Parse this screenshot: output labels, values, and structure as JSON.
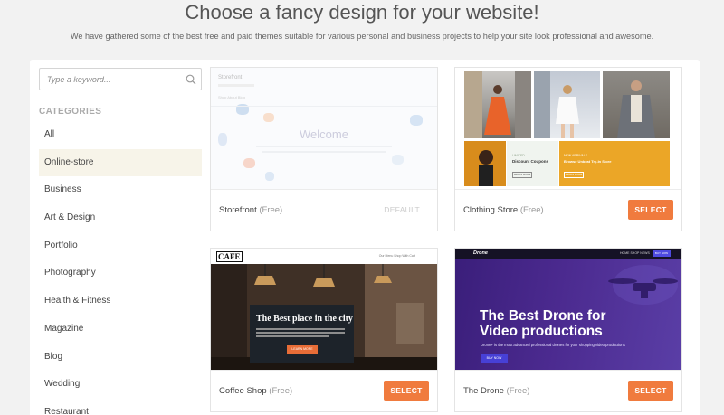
{
  "hero": {
    "title": "Choose a fancy design for your website!",
    "subtitle": "We have gathered some of the best free and paid themes suitable for various personal and business projects to help your site look professional and awesome."
  },
  "search": {
    "placeholder": "Type a keyword..."
  },
  "categories": {
    "heading": "CATEGORIES",
    "items": [
      "All",
      "Online-store",
      "Business",
      "Art & Design",
      "Portfolio",
      "Photography",
      "Health & Fitness",
      "Magazine",
      "Blog",
      "Wedding",
      "Restaurant"
    ],
    "active": "Online-store"
  },
  "themes": [
    {
      "name": "Storefront",
      "price": "(Free)",
      "action": "DEFAULT",
      "thumb": {
        "brand": "Storefront",
        "nav": "Shop   About   Blog",
        "headline": "Welcome"
      }
    },
    {
      "name": "Clothing Store",
      "price": "(Free)",
      "action": "SELECT",
      "thumb": {
        "promo_label": "LIMITED",
        "promo_title": "Discount Coupons",
        "promo_btn": "LEARN MORE",
        "promo2_label": "NEW ARRIVALS",
        "promo2_title": "Browse Unbeat Try-In Store",
        "promo2_btn": "LEARN MORE"
      }
    },
    {
      "name": "Coffee Shop",
      "price": "(Free)",
      "action": "SELECT",
      "thumb": {
        "logo": "CAFE",
        "nav": "Our Menu   Shop With   Cart",
        "headline": "The Best place in the city",
        "button": "LEARN MORE"
      }
    },
    {
      "name": "The Drone",
      "price": "(Free)",
      "action": "SELECT",
      "thumb": {
        "logo": "Drone",
        "nav": "HOME   SHOP   NEWS",
        "cta": "BUY NOW",
        "headline_1": "The Best Drone for",
        "headline_2": "Video productions",
        "text": "Drone+ is the most advanced professional drones for your shopping video productions",
        "button": "BUY NOW"
      }
    }
  ],
  "colors": {
    "accent": "#f07b3e",
    "background": "#f2f2f2",
    "active_category": "#f7f4e9"
  }
}
